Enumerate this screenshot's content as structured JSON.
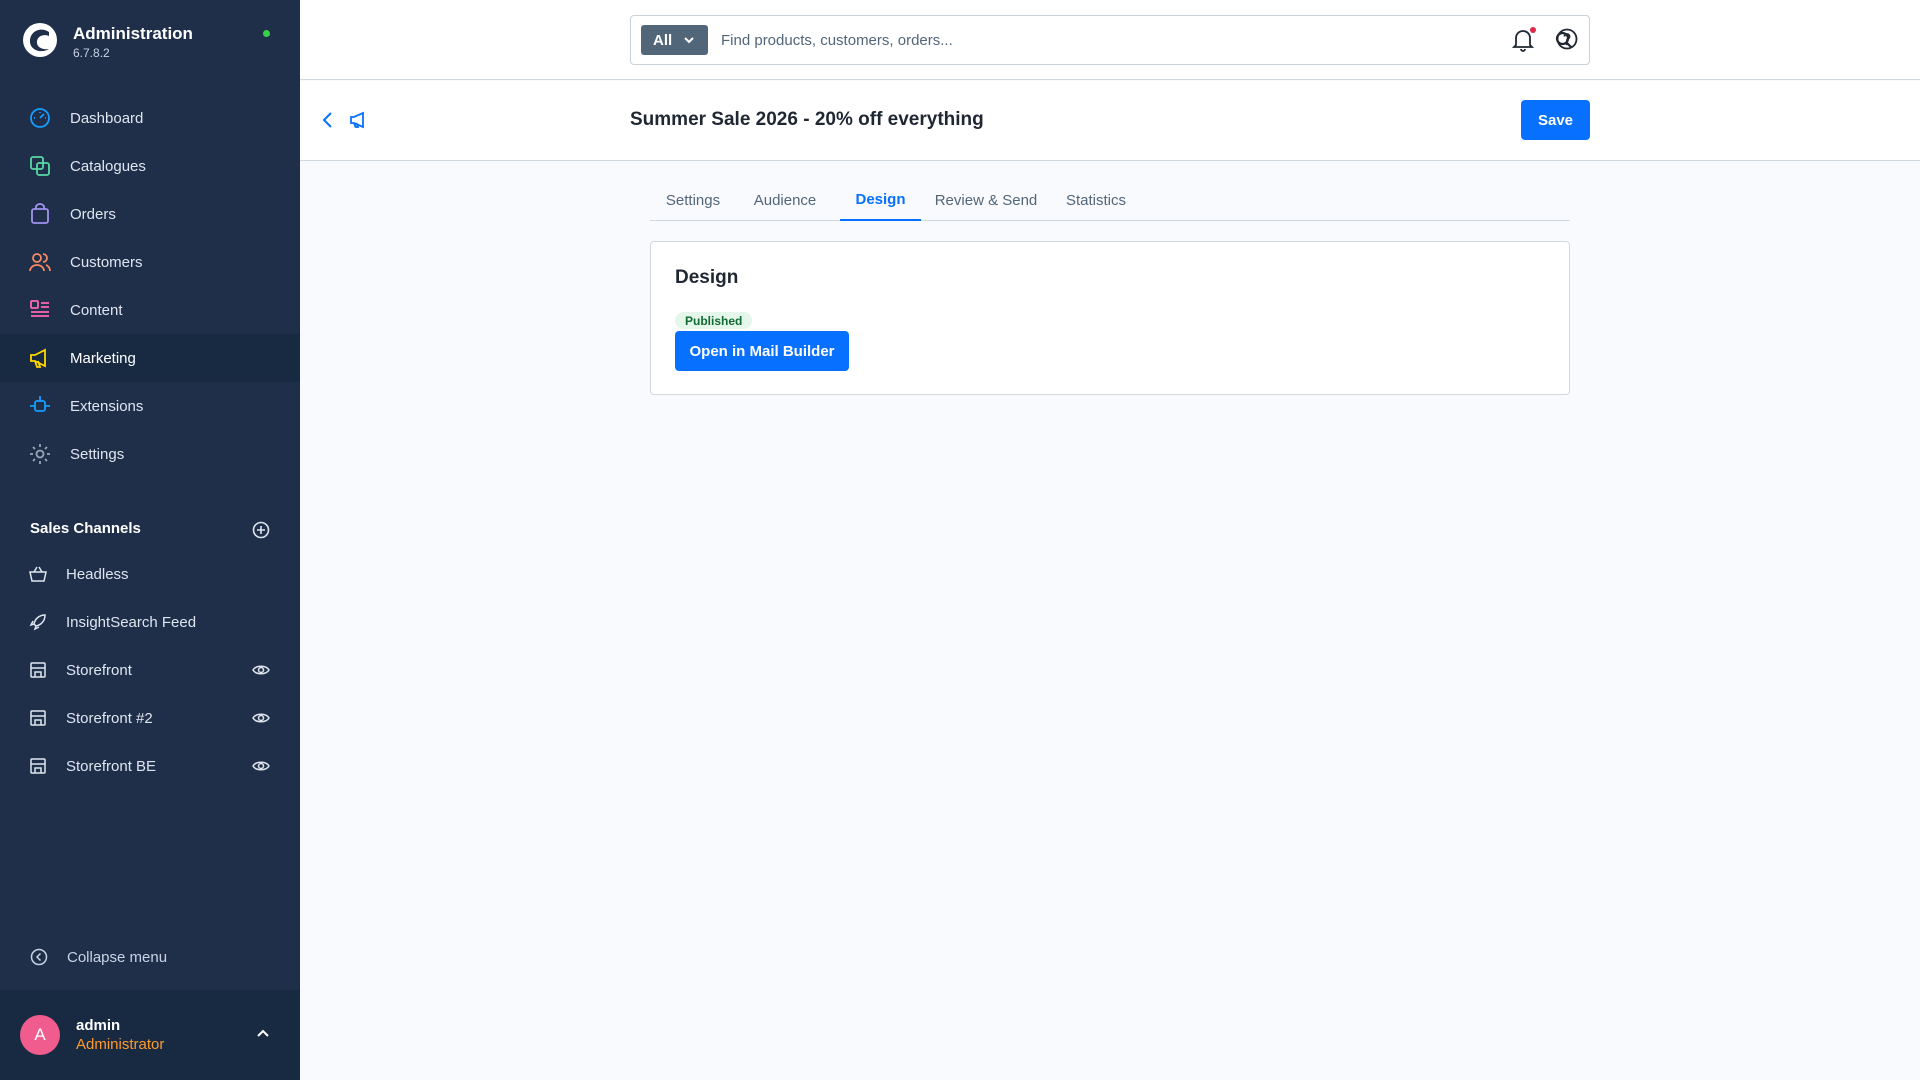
{
  "app": {
    "title": "Administration",
    "version": "6.7.8.2"
  },
  "sidebar": {
    "items": [
      {
        "label": "Dashboard",
        "icon": "dashboard-icon",
        "color": "#189eff"
      },
      {
        "label": "Catalogues",
        "icon": "catalogue-icon",
        "color": "#57d9a3"
      },
      {
        "label": "Orders",
        "icon": "bag-icon",
        "color": "#a092f0"
      },
      {
        "label": "Customers",
        "icon": "users-icon",
        "color": "#f88962"
      },
      {
        "label": "Content",
        "icon": "content-icon",
        "color": "#ff68b4"
      },
      {
        "label": "Marketing",
        "icon": "megaphone-icon",
        "color": "#ffd700",
        "active": true
      },
      {
        "label": "Extensions",
        "icon": "plug-icon",
        "color": "#189eff"
      },
      {
        "label": "Settings",
        "icon": "gear-icon",
        "color": "#9aa8b5"
      }
    ],
    "sales_channels_title": "Sales Channels",
    "sales_channels": [
      {
        "label": "Headless",
        "icon": "basket-icon"
      },
      {
        "label": "InsightSearch Feed",
        "icon": "rocket-icon"
      },
      {
        "label": "Storefront",
        "icon": "storefront-icon",
        "eye": true
      },
      {
        "label": "Storefront #2",
        "icon": "storefront-icon",
        "eye": true
      },
      {
        "label": "Storefront BE",
        "icon": "storefront-icon",
        "eye": true
      }
    ],
    "collapse_label": "Collapse menu"
  },
  "user": {
    "initial": "A",
    "name": "admin",
    "role": "Administrator"
  },
  "search": {
    "type_label": "All",
    "placeholder": "Find products, customers, orders..."
  },
  "page": {
    "title": "Summer Sale 2026 - 20% off everything",
    "save_label": "Save"
  },
  "tabs": [
    {
      "label": "Settings"
    },
    {
      "label": "Audience"
    },
    {
      "label": "Design",
      "active": true
    },
    {
      "label": "Review & Send"
    },
    {
      "label": "Statistics"
    }
  ],
  "card": {
    "title": "Design",
    "status": "Published",
    "button_label": "Open in Mail Builder"
  },
  "colors": {
    "accent": "#0870ff",
    "sidebar_bg": "#1f2f4a",
    "sidebar_active_bg": "#182a42",
    "status_green": "#37d046",
    "role_orange": "#ff9a2b"
  }
}
